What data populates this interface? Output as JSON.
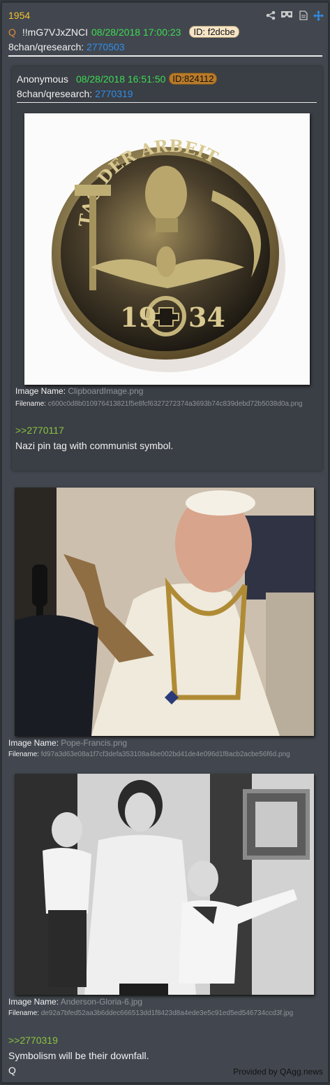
{
  "post": {
    "number": "1954",
    "author_mark": "Q",
    "tripcode": "!!mG7VJxZNCI",
    "date": "08/28/2018 17:00:23",
    "id_label": "ID: f2dcbe",
    "board": "8chan/qresearch:",
    "thread": "2770503"
  },
  "quoted": {
    "author": "Anonymous",
    "date": "08/28/2018 16:51:50",
    "id_label": "ID:824112",
    "board": "8chan/qresearch:",
    "thread": "2770319",
    "image": {
      "name_label": "Image Name:",
      "name": "ClipboardImage.png",
      "file_label": "Filename:",
      "file": "c600c0d8b010976413821f5e8fcf6327272374a3693b74c839debd72b5038d0a.png",
      "medal_top": "TAG DER ARBEIT",
      "medal_year_left": "19",
      "medal_year_right": "34"
    },
    "reply_ref": ">>2770117",
    "text": "Nazi pin tag with communist symbol."
  },
  "images": [
    {
      "name_label": "Image Name:",
      "name": "Pope-Francis.png",
      "file_label": "Filename:",
      "file": "fd97a3d63e08a1f7cf3defa353108a4be002bd41de4e096d1f8acb2acbe56f6d.png"
    },
    {
      "name_label": "Image Name:",
      "name": "Anderson-Gloria-6.jpg",
      "file_label": "Filename:",
      "file": "de92a7bfed52aa3b6ddec666513dd1f8423d8a4ede3e5c91ed5ed546734ccd3f.jpg"
    }
  ],
  "reply_ref": ">>2770319",
  "text_line1": "Symbolism will be their downfall.",
  "signature": "Q",
  "footer": "Provided by QAgg.news",
  "icons": [
    "share-icon",
    "vr-icon",
    "document-icon",
    "move-icon"
  ],
  "colors": {
    "background": "#353a41",
    "post": "#42474f",
    "post_number": "#f2c12e",
    "date": "#3ddc52",
    "link": "#2f8fea",
    "greentext": "#8ac43f",
    "q_mark": "#e08a3c"
  }
}
